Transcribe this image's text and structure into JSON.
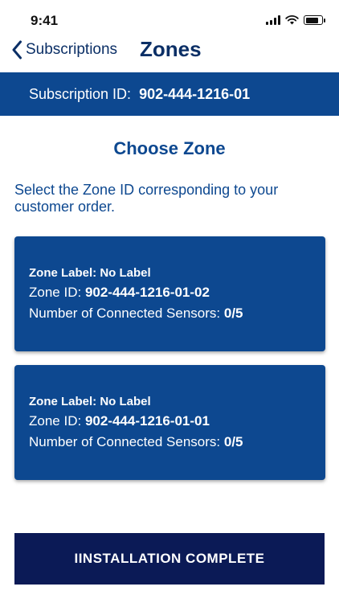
{
  "status_bar": {
    "time": "9:41"
  },
  "nav": {
    "back_label": "Subscriptions",
    "title": "Zones"
  },
  "banner": {
    "label": "Subscription ID:",
    "value": "902-444-1216-01"
  },
  "section_title": "Choose Zone",
  "instructions": "Select the Zone ID corresponding to your customer order.",
  "zones": [
    {
      "label_caption": "Zone Label:",
      "label_value": "No Label",
      "id_caption": "Zone ID:",
      "id_value": "902-444-1216-01-02",
      "sensors_caption": "Number of Connected Sensors:",
      "sensors_value": "0/5"
    },
    {
      "label_caption": "Zone Label:",
      "label_value": "No Label",
      "id_caption": "Zone ID:",
      "id_value": "902-444-1216-01-01",
      "sensors_caption": "Number of Connected Sensors:",
      "sensors_value": "0/5"
    }
  ],
  "complete_button": "IINSTALLATION COMPLETE",
  "colors": {
    "primary": "#0d4890",
    "button_dark": "#0b1a56",
    "nav_text": "#0b2f66"
  }
}
